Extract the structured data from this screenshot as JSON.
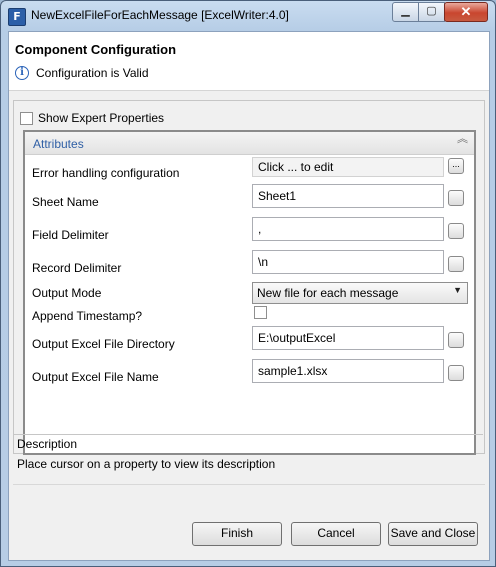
{
  "window": {
    "title": "NewExcelFileForEachMessage [ExcelWriter:4.0]",
    "icon_letter": "F"
  },
  "controls": {
    "minimize": "▁",
    "maximize": "▢",
    "close": "✕"
  },
  "header": {
    "title": "Component Configuration",
    "status": "Configuration is Valid",
    "info_glyph": "i"
  },
  "expert": {
    "label": "Show Expert Properties"
  },
  "attributes": {
    "title": "Attributes",
    "collapse_glyph": "≪",
    "error_label": "Error handling configuration",
    "error_value": "Click ... to edit",
    "rows": [
      {
        "label": "Sheet Name",
        "value": "Sheet1"
      },
      {
        "label": "Field Delimiter",
        "value": ","
      },
      {
        "label": "Record Delimiter",
        "value": "\\n"
      }
    ],
    "output_mode_label": "Output Mode",
    "output_mode_value": "New file for each message",
    "append_label": "Append Timestamp?",
    "rows2": [
      {
        "label": "Output Excel File Directory",
        "value": "E:\\outputExcel"
      },
      {
        "label": "Output Excel File Name",
        "value": "sample1.xlsx"
      }
    ]
  },
  "description": {
    "title": "Description",
    "text": "Place cursor on a property to view its description"
  },
  "buttons": {
    "finish": "Finish",
    "cancel": "Cancel",
    "save": "Save and Close"
  },
  "ellipsis": "..."
}
